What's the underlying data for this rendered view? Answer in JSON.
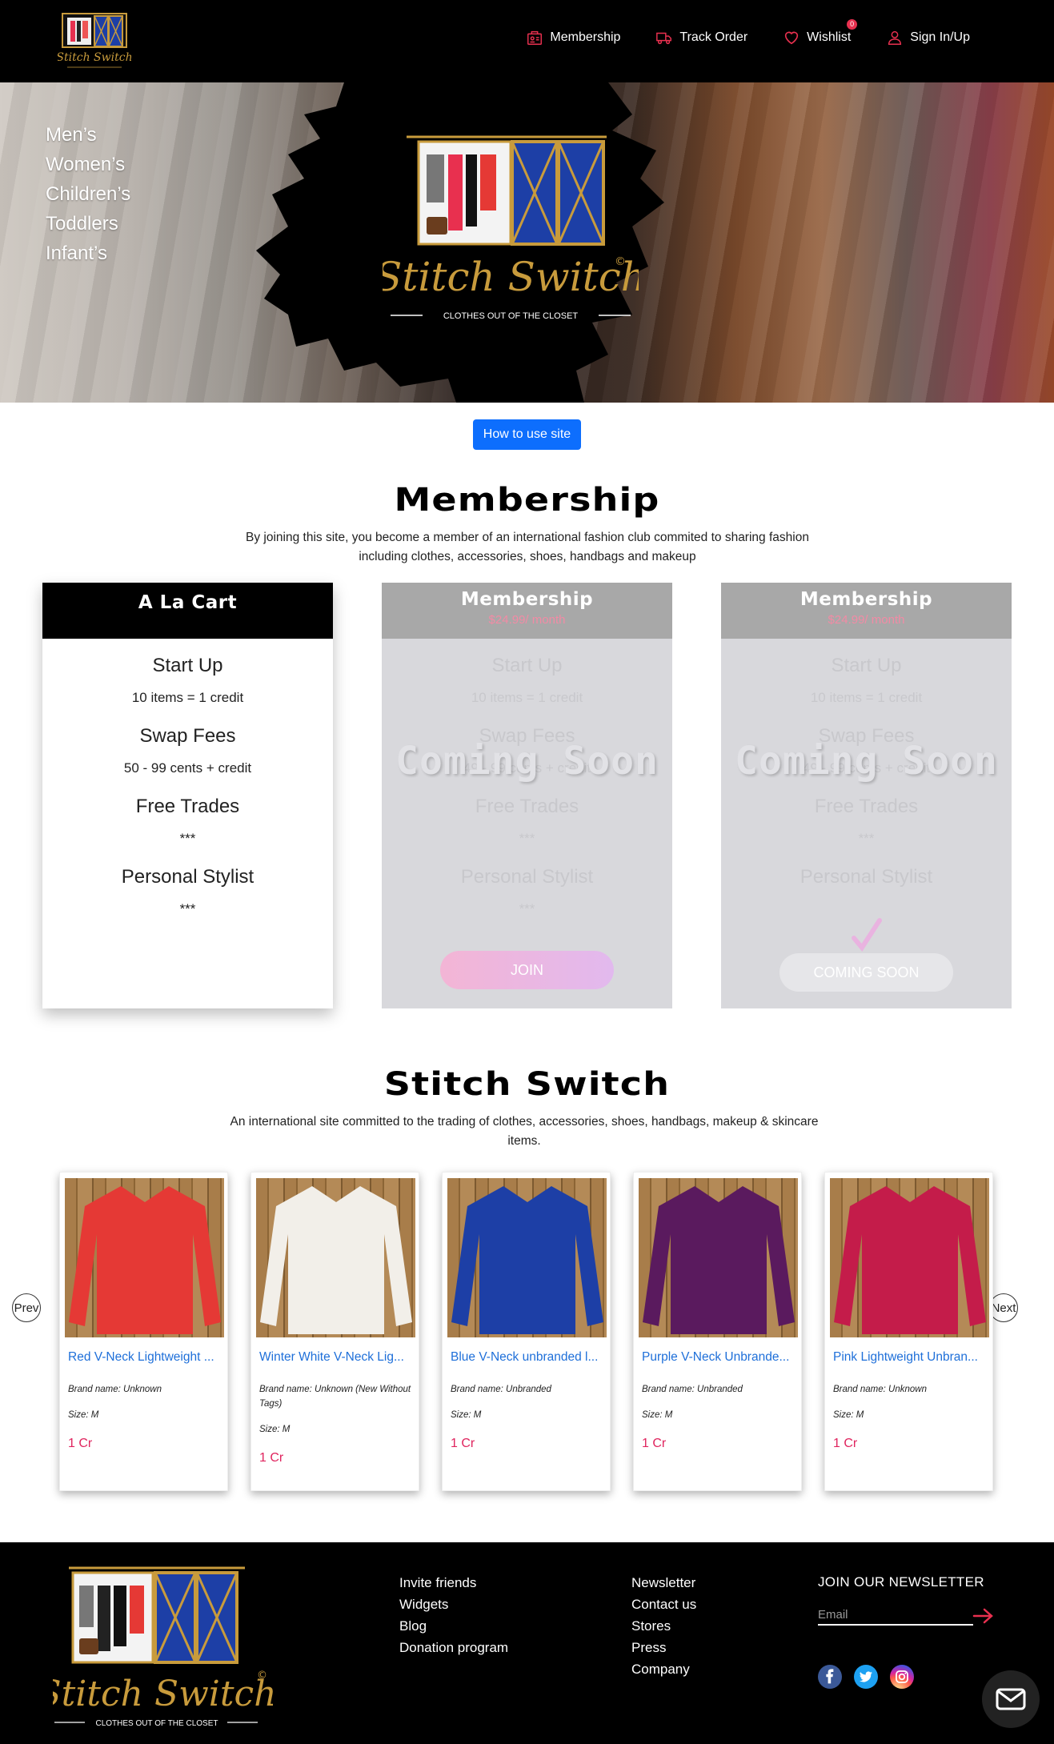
{
  "nav": {
    "links": [
      {
        "label": "Membership",
        "icon": "membership-icon"
      },
      {
        "label": "Track Order",
        "icon": "truck-icon"
      },
      {
        "label": "Wishlist",
        "icon": "heart-icon"
      },
      {
        "label": "Sign In/Up",
        "icon": "user-icon"
      }
    ],
    "wishlist_count": "0"
  },
  "hero": {
    "categories": [
      "Men’s",
      "Women’s",
      "Children’s",
      "Toddlers",
      "Infant’s"
    ],
    "logo": {
      "wordmark": "Stitch Switch",
      "copyright": "©",
      "tagline": "CLOTHES OUT OF THE CLOSET"
    }
  },
  "howto_label": "How to use site",
  "membership": {
    "title": "Membership",
    "description": "By joining this site, you become a member of an international fashion club commited to sharing fashion including clothes, accessories, shoes, handbags and makeup",
    "cards": [
      {
        "title": "A La Cart",
        "price": "",
        "startup_label": "Start Up",
        "startup_value": "10 items = 1 credit",
        "swap_label": "Swap Fees",
        "swap_value": "50 - 99 cents + credit",
        "trades_label": "Free Trades",
        "trades_value": "***",
        "stylist_label": "Personal Stylist",
        "stylist_value": "***"
      },
      {
        "title": "Membership",
        "price": "$24.99/ month",
        "startup_label": "Start Up",
        "startup_value": "10 items = 1 credit",
        "swap_label": "Swap Fees",
        "swap_value": "49 - 99 cents + credit",
        "trades_label": "Free Trades",
        "trades_value": "***",
        "stylist_label": "Personal Stylist",
        "stylist_value": "***",
        "overlay": "Coming Soon",
        "button": "JOIN"
      },
      {
        "title": "Membership",
        "price": "$24.99/ month",
        "startup_label": "Start Up",
        "startup_value": "10 items = 1 credit",
        "swap_label": "Swap Fees",
        "swap_value": "49 - 99 cents + credit",
        "trades_label": "Free Trades",
        "trades_value": "***",
        "stylist_label": "Personal Stylist",
        "stylist_value": "",
        "overlay": "Coming Soon",
        "button": "COMING SOON"
      }
    ]
  },
  "shop": {
    "title": "Stitch Switch",
    "description": "An international site committed to the trading of clothes, accessories, shoes, handbags, makeup & skincare items.",
    "prev": "Prev",
    "next": "Next",
    "products": [
      {
        "name": "Red V-Neck Lightweight ...",
        "brand": "Brand name: Unknown",
        "size": "Size: M",
        "price": "1 Cr",
        "color": "#e53935"
      },
      {
        "name": "Winter White V-Neck Lig...",
        "brand": "Brand name: Unknown (New Without Tags)",
        "size": "Size: M",
        "price": "1 Cr",
        "color": "#f2efe9"
      },
      {
        "name": "Blue V-Neck unbranded l...",
        "brand": "Brand name: Unbranded",
        "size": "Size: M",
        "price": "1 Cr",
        "color": "#1d3fa6"
      },
      {
        "name": "Purple V-Neck Unbrande...",
        "brand": "Brand name: Unbranded",
        "size": "Size: M",
        "price": "1 Cr",
        "color": "#5a1a5e"
      },
      {
        "name": "Pink Lightweight Unbran...",
        "brand": "Brand name: Unknown",
        "size": "Size: M",
        "price": "1 Cr",
        "color": "#c41c4a"
      }
    ]
  },
  "footer": {
    "col1": [
      "Invite friends",
      "Widgets",
      "Blog",
      "Donation program"
    ],
    "col2": [
      "Newsletter",
      "Contact us",
      "Stores",
      "Press",
      "Company"
    ],
    "newsletter_title": "JOIN OUR NEWSLETTER",
    "email_placeholder": "Email",
    "social": [
      "facebook-icon",
      "twitter-icon",
      "instagram-icon"
    ]
  },
  "colors": {
    "accent": "#e0245e",
    "primary_button": "#0d6efd",
    "link": "#1e6fd9",
    "gold": "#c89b3c"
  }
}
